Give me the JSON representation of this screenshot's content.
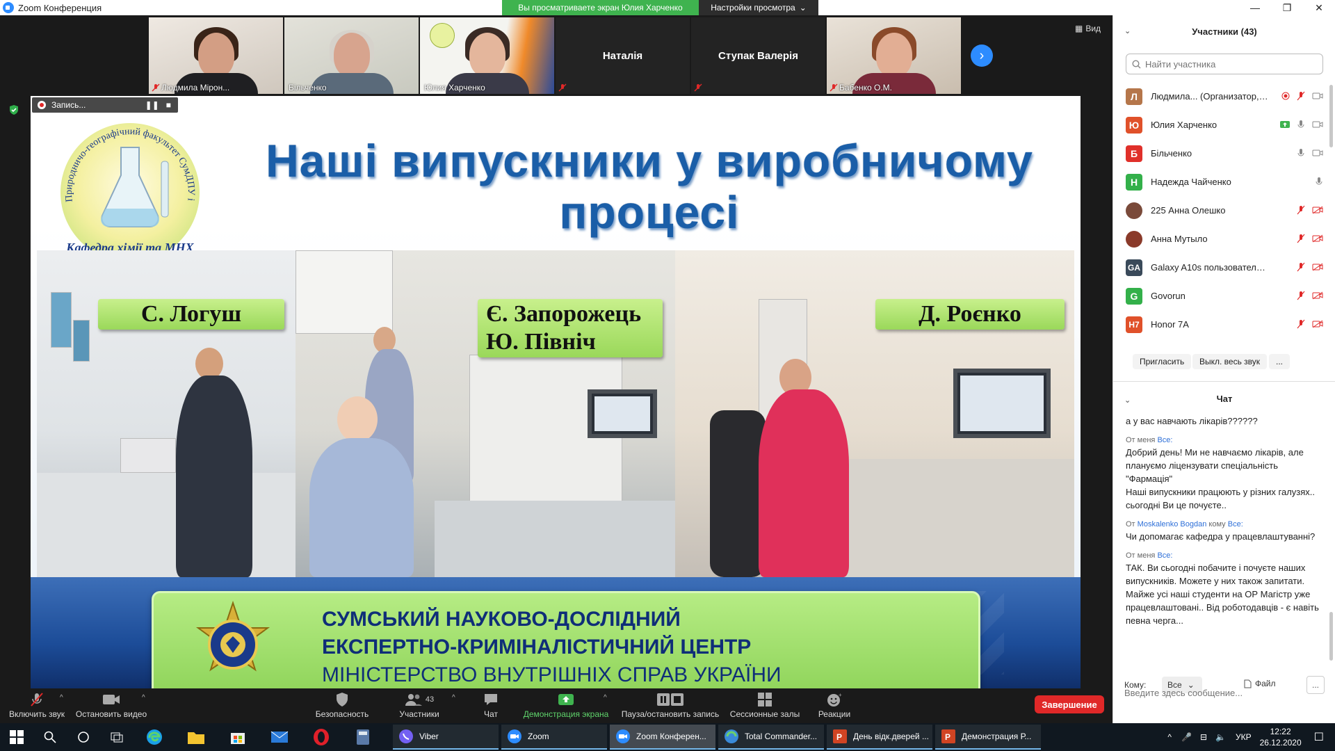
{
  "window": {
    "title": "Zoom Конференция",
    "share_banner": "Вы просматриваете экран Юлия Харченко",
    "view_options": "Настройки просмотра",
    "view_label": "Вид"
  },
  "gallery": [
    {
      "name": "Людмила Мірон...",
      "muted": true,
      "video": true
    },
    {
      "name": "Більченко",
      "muted": false,
      "video": true
    },
    {
      "name": "Юлия Харченко",
      "muted": false,
      "video": true
    },
    {
      "name": "Наталія",
      "muted": true,
      "video": false
    },
    {
      "name": "Ступак Валерія",
      "muted": true,
      "video": false
    },
    {
      "name": "Бабенко О.М.",
      "muted": true,
      "video": true
    }
  ],
  "recording": {
    "label": "Запись..."
  },
  "slide": {
    "logo_text_top": "Природничо-географічний факультет СумДПУ імені А.С.Макаренка",
    "logo_text_bottom": "Кафедра хімії та МНХ",
    "title_line1": "Наші випускники у виробничому",
    "title_line2": "процесі",
    "labels": [
      "С. Логуш",
      "Є. Запорожець",
      "Ю. Північ",
      "Д. Роєнко"
    ],
    "center_line1": "СУМСЬКИЙ НАУКОВО-ДОСЛІДНИЙ",
    "center_line2": "ЕКСПЕРТНО-КРИМІНАЛІСТИЧНИЙ ЦЕНТР",
    "center_line3": "МІНІСТЕРСТВО ВНУТРІШНІХ СПРАВ УКРАЇНИ"
  },
  "toolbar": {
    "unmute": "Включить звук",
    "stop_video": "Остановить видео",
    "security": "Безопасность",
    "participants": "Участники",
    "participants_count": "43",
    "chat": "Чат",
    "share_screen": "Демонстрация экрана",
    "pause_record": "Пауза/остановить запись",
    "breakout": "Сессионные залы",
    "reactions": "Реакции",
    "end": "Завершение"
  },
  "participants_panel": {
    "title": "Участники (43)",
    "search_placeholder": "Найти участника",
    "list": [
      {
        "initial": "Л",
        "name": "Людмила... (Организатор, я)",
        "color": "#b5764a"
      },
      {
        "initial": "Ю",
        "name": "Юлия Харченко",
        "color": "#e0512a"
      },
      {
        "initial": "Б",
        "name": "Більченко",
        "color": "#e0302a"
      },
      {
        "initial": "Н",
        "name": "Надежда Чайченко",
        "color": "#33b04a"
      },
      {
        "initial": "",
        "name": "225 Анна Олешко",
        "color": "#7a4a3a"
      },
      {
        "initial": "",
        "name": "Анна Мутыло",
        "color": "#8a3a2a"
      },
      {
        "initial": "GA",
        "name": "Galaxy A10s пользователя Пол...",
        "color": "#3a4a5a"
      },
      {
        "initial": "G",
        "name": "Govorun",
        "color": "#33b04a"
      },
      {
        "initial": "H7",
        "name": "Honor 7A",
        "color": "#e0512a"
      }
    ],
    "invite": "Пригласить",
    "mute_all": "Выкл. весь звук",
    "more": "..."
  },
  "chat": {
    "title": "Чат",
    "messages": [
      {
        "meta_from": "",
        "meta_to": "",
        "text": "а у вас навчають лікарів??????"
      },
      {
        "meta_from": "От меня",
        "meta_to": "Все:",
        "text": "Добрий день! Ми не навчаємо лікарів, але плануємо ліцензувати спеціальність \"Фармація\"\nНаші випускники працюють у різних галузях.. сьогодні Ви це почуєте.."
      },
      {
        "meta_from": "От",
        "meta_sender": "Moskalenko Bogdan",
        "meta_mid": "кому",
        "meta_to": "Все:",
        "text": "Чи допомагає кафедра у працевлаштуванні?"
      },
      {
        "meta_from": "От меня",
        "meta_to": "Все:",
        "text": "ТАК. Ви сьогодні побачите і почуєте наших випускників. Можете у них також запитати. Майже усі наші студенти на ОР Магістр уже працевлаштовані.. Від роботодавців - є навіть певна черга..."
      }
    ],
    "to_label": "Кому:",
    "to_value": "Все",
    "file_label": "Файл",
    "more": "...",
    "input_placeholder": "Введите здесь сообщение..."
  },
  "taskbar": {
    "apps": [
      "Viber",
      "Zoom",
      "Zoom Конферен...",
      "Total Commander...",
      "День відк.дверей ...",
      "Демонстрация Р..."
    ],
    "lang": "УКР",
    "time": "12:22",
    "date": "26.12.2020"
  },
  "colors": {
    "zoom_blue": "#2D8CFF",
    "share_green": "#3fb34f",
    "end_red": "#e02828",
    "slide_title_blue": "#1a5ea8"
  }
}
